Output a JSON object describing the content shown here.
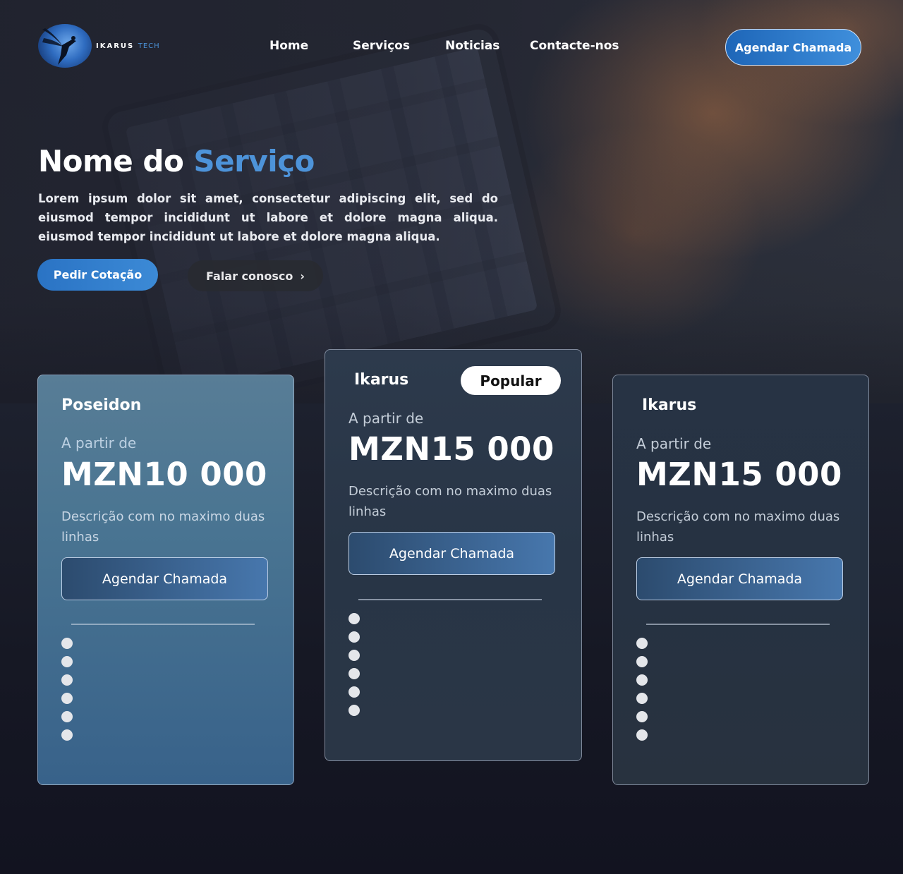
{
  "brand": {
    "name": "IKARUS",
    "suffix": "TECH"
  },
  "nav": {
    "items": [
      "Home",
      "Serviços",
      "Noticias",
      "Contacte-nos"
    ],
    "cta": "Agendar Chamada"
  },
  "hero": {
    "title_main": "Nome do ",
    "title_accent": "Serviço",
    "description": "Lorem ipsum dolor sit amet, consectetur adipiscing elit, sed do eiusmod tempor incididunt ut labore et dolore magna aliqua. eiusmod tempor incididunt ut labore et dolore magna aliqua.",
    "primary_button": "Pedir Cotação",
    "secondary_button": "Falar conosco",
    "secondary_icon": "›"
  },
  "plans": [
    {
      "name": "Poseidon",
      "from_label": "A partir de",
      "price": "MZN10 000",
      "description": "Descrição com no maximo duas linhas",
      "button": "Agendar Chamada",
      "bullet_count": 6
    },
    {
      "name": "Ikarus",
      "badge": "Popular",
      "from_label": "A partir de",
      "price": "MZN15 000",
      "description": "Descrição com no maximo duas linhas",
      "button": "Agendar Chamada",
      "bullet_count": 6
    },
    {
      "name": "Ikarus",
      "from_label": "A partir de",
      "price": "MZN15 000",
      "description": "Descrição com no maximo duas linhas",
      "button": "Agendar Chamada",
      "bullet_count": 6
    }
  ],
  "colors": {
    "accent": "#4d93d9",
    "button_blue": "#2a73c4",
    "background": "#14151f"
  }
}
